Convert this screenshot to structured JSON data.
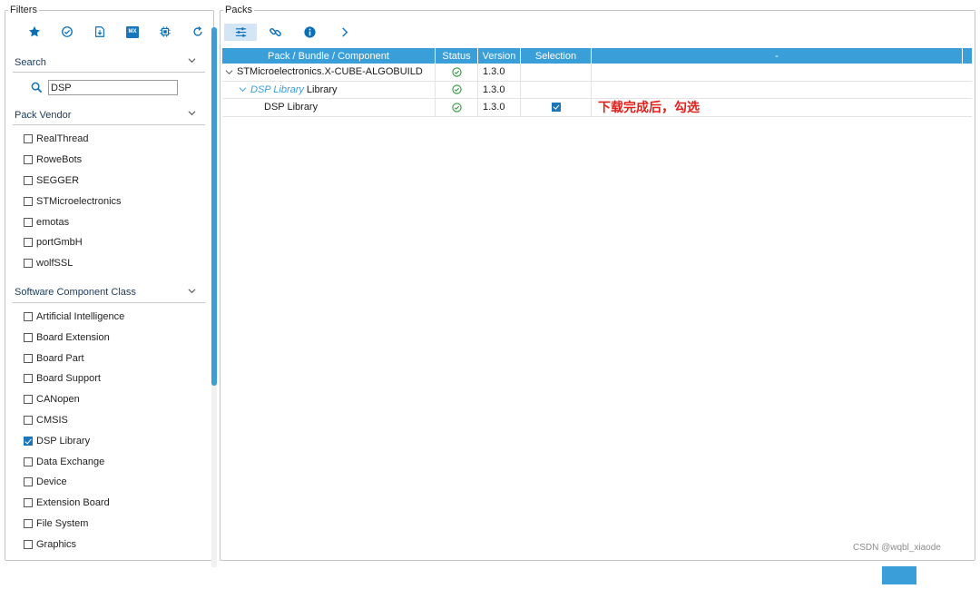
{
  "filters": {
    "title": "Filters",
    "toolbar": [
      {
        "name": "star-icon"
      },
      {
        "name": "check-circle-icon"
      },
      {
        "name": "download-icon"
      },
      {
        "name": "mx-icon",
        "label": "MX"
      },
      {
        "name": "chip-icon"
      },
      {
        "name": "refresh-icon"
      }
    ],
    "search": {
      "header": "Search",
      "value": "DSP"
    },
    "pack_vendor": {
      "header": "Pack Vendor",
      "items": [
        {
          "label": "RealThread",
          "checked": false
        },
        {
          "label": "RoweBots",
          "checked": false
        },
        {
          "label": "SEGGER",
          "checked": false
        },
        {
          "label": "STMicroelectronics",
          "checked": false
        },
        {
          "label": "emotas",
          "checked": false
        },
        {
          "label": "portGmbH",
          "checked": false
        },
        {
          "label": "wolfSSL",
          "checked": false
        }
      ]
    },
    "component_class": {
      "header": "Software Component Class",
      "items": [
        {
          "label": "Artificial Intelligence",
          "checked": false
        },
        {
          "label": "Board Extension",
          "checked": false
        },
        {
          "label": "Board Part",
          "checked": false
        },
        {
          "label": "Board Support",
          "checked": false
        },
        {
          "label": "CANopen",
          "checked": false
        },
        {
          "label": "CMSIS",
          "checked": false
        },
        {
          "label": "DSP Library",
          "checked": true
        },
        {
          "label": "Data Exchange",
          "checked": false
        },
        {
          "label": "Device",
          "checked": false
        },
        {
          "label": "Extension Board",
          "checked": false
        },
        {
          "label": "File System",
          "checked": false
        },
        {
          "label": "Graphics",
          "checked": false
        }
      ]
    }
  },
  "packs": {
    "title": "Packs",
    "columns": {
      "component": "Pack / Bundle / Component",
      "status": "Status",
      "version": "Version",
      "selection": "Selection",
      "extra": "-"
    },
    "rows": [
      {
        "component": "STMicroelectronics.X-CUBE-ALGOBUILD",
        "version": "1.3.0"
      },
      {
        "component_link": "DSP Library",
        "component_suffix": "Library",
        "version": "1.3.0"
      },
      {
        "component": "DSP Library",
        "version": "1.3.0",
        "selected": true,
        "annotation": "下载完成后，勾选"
      }
    ]
  },
  "watermark": "CSDN @wqbl_xiaode"
}
